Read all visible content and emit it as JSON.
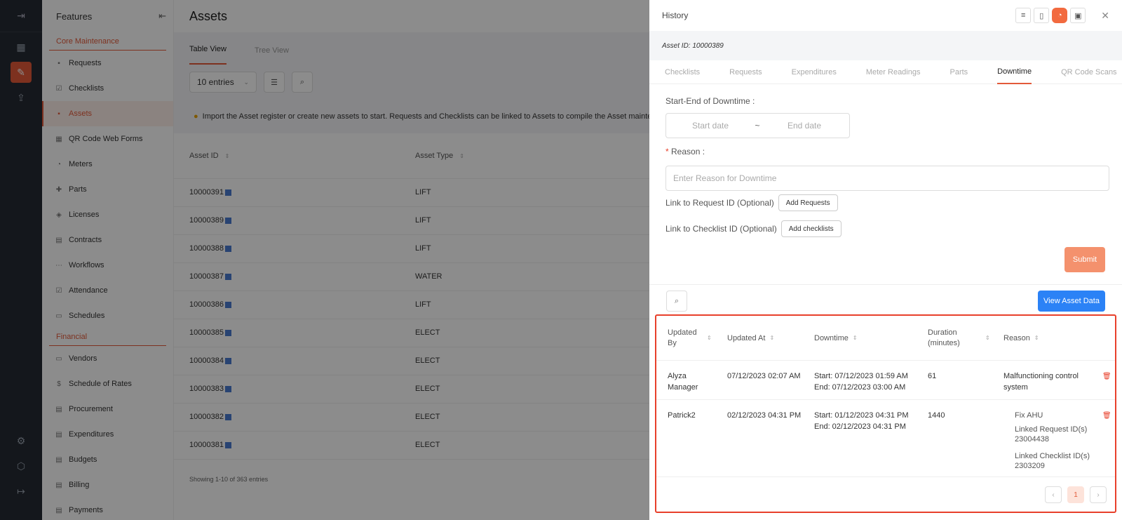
{
  "sidebar": {
    "title": "Features",
    "section_core": "Core Maintenance",
    "core_items": [
      {
        "label": "Requests",
        "icon": "request-icon"
      },
      {
        "label": "Checklists",
        "icon": "checklist-icon"
      },
      {
        "label": "Assets",
        "icon": "asset-icon"
      },
      {
        "label": "QR Code Web Forms",
        "icon": "qr-icon"
      },
      {
        "label": "Meters",
        "icon": "meter-icon"
      },
      {
        "label": "Parts",
        "icon": "parts-icon"
      },
      {
        "label": "Licenses",
        "icon": "license-icon"
      },
      {
        "label": "Contracts",
        "icon": "contract-icon"
      },
      {
        "label": "Workflows",
        "icon": "workflow-icon"
      },
      {
        "label": "Attendance",
        "icon": "attendance-icon"
      },
      {
        "label": "Schedules",
        "icon": "schedule-icon"
      }
    ],
    "section_financial": "Financial",
    "fin_items": [
      {
        "label": "Vendors",
        "icon": "vendor-icon"
      },
      {
        "label": "Schedule of Rates",
        "icon": "dollar-icon"
      },
      {
        "label": "Procurement",
        "icon": "procurement-icon"
      },
      {
        "label": "Expenditures",
        "icon": "expenditure-icon"
      },
      {
        "label": "Budgets",
        "icon": "budget-icon"
      },
      {
        "label": "Billing",
        "icon": "billing-icon"
      },
      {
        "label": "Payments",
        "icon": "payment-icon"
      }
    ]
  },
  "main": {
    "title": "Assets",
    "tabs": [
      "Table View",
      "Tree View"
    ],
    "entries": "10 entries",
    "info": "Import the Asset register or create new assets to start. Requests and Checklists can be linked to Assets to compile the Asset maintenance",
    "columns": [
      "Asset ID",
      "Asset Type"
    ],
    "rows": [
      {
        "id": "10000391",
        "type": "LIFT"
      },
      {
        "id": "10000389",
        "type": "LIFT"
      },
      {
        "id": "10000388",
        "type": "LIFT"
      },
      {
        "id": "10000387",
        "type": "WATER"
      },
      {
        "id": "10000386",
        "type": "LIFT"
      },
      {
        "id": "10000385",
        "type": "ELECT"
      },
      {
        "id": "10000384",
        "type": "ELECT"
      },
      {
        "id": "10000383",
        "type": "ELECT"
      },
      {
        "id": "10000382",
        "type": "ELECT"
      },
      {
        "id": "10000381",
        "type": "ELECT"
      }
    ],
    "showing": "Showing 1-10 of 363 entries"
  },
  "drawer": {
    "title": "History",
    "asset_id": "Asset ID: 10000389",
    "tabs": [
      "Checklists",
      "Requests",
      "Expenditures",
      "Meter Readings",
      "Parts",
      "Downtime",
      "QR Code Scans"
    ],
    "range_label": "Start-End of Downtime :",
    "start_placeholder": "Start date",
    "range_sep": "~",
    "end_placeholder": "End date",
    "reason_label": "Reason :",
    "reason_placeholder": "Enter Reason for Downtime",
    "link_request_label": "Link to Request ID (Optional)",
    "add_requests": "Add Requests",
    "link_checklist_label": "Link to Checklist ID (Optional)",
    "add_checklists": "Add checklists",
    "submit": "Submit",
    "view_asset_data": "View Asset Data",
    "table": {
      "headers": [
        "Updated By",
        "Updated At",
        "Downtime",
        "Duration (minutes)",
        "Reason"
      ],
      "rows": [
        {
          "by": "Alyza Manager",
          "at": "07/12/2023 02:07 AM",
          "start": "Start: 07/12/2023 01:59 AM",
          "end": "End: 07/12/2023 03:00 AM",
          "duration": "61",
          "reason": "Malfunctioning control system"
        },
        {
          "by": "Patrick2",
          "at": "02/12/2023 04:31 PM",
          "start": "Start: 01/12/2023 04:31 PM",
          "end": "End: 02/12/2023 04:31 PM",
          "duration": "1440",
          "reason": "Fix AHU",
          "req_label": "Linked Request ID(s)",
          "req_id": "23004438",
          "chk_label": "Linked Checklist ID(s)",
          "chk_id": "2303209"
        }
      ]
    },
    "page": "1"
  },
  "colors": {
    "accent": "#e35a3a",
    "primary": "#2b82f6",
    "highlight": "#e8402b"
  }
}
